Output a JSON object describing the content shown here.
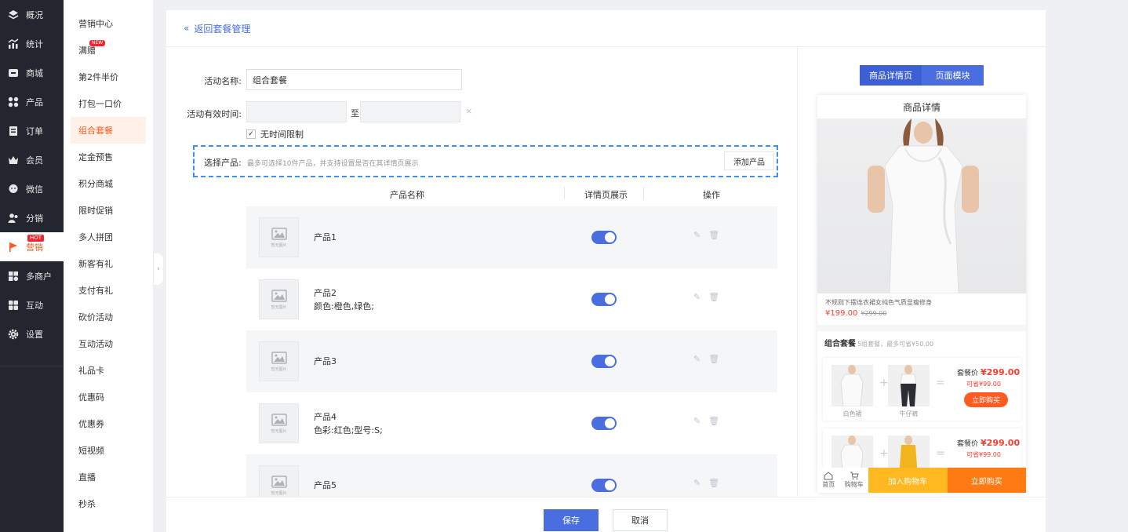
{
  "nav": {
    "items": [
      {
        "label": "概况",
        "icon": "layers-icon"
      },
      {
        "label": "统计",
        "icon": "chart-icon"
      },
      {
        "label": "商城",
        "icon": "store-icon"
      },
      {
        "label": "产品",
        "icon": "grid-icon"
      },
      {
        "label": "订单",
        "icon": "order-icon"
      },
      {
        "label": "会员",
        "icon": "crown-icon"
      },
      {
        "label": "微信",
        "icon": "wechat-icon"
      },
      {
        "label": "分销",
        "icon": "distribution-icon"
      },
      {
        "label": "营销",
        "icon": "flag-icon",
        "badge": "HOT"
      },
      {
        "label": "多商户",
        "icon": "merchant-icon"
      },
      {
        "label": "互动",
        "icon": "interaction-icon"
      },
      {
        "label": "设置",
        "icon": "gear-icon"
      }
    ]
  },
  "subnav": {
    "items": [
      {
        "label": "营销中心"
      },
      {
        "label": "满赠",
        "badge": "NEW"
      },
      {
        "label": "第2件半价"
      },
      {
        "label": "打包一口价"
      },
      {
        "label": "组合套餐"
      },
      {
        "label": "定金预售"
      },
      {
        "label": "积分商城"
      },
      {
        "label": "限时促销"
      },
      {
        "label": "多人拼团"
      },
      {
        "label": "新客有礼"
      },
      {
        "label": "支付有礼"
      },
      {
        "label": "砍价活动"
      },
      {
        "label": "互动活动"
      },
      {
        "label": "礼品卡"
      },
      {
        "label": "优惠码"
      },
      {
        "label": "优惠券"
      },
      {
        "label": "短视频"
      },
      {
        "label": "直播"
      },
      {
        "label": "秒杀"
      }
    ]
  },
  "header": {
    "back": "返回套餐管理"
  },
  "form": {
    "name_label": "活动名称:",
    "name_value": "组合套餐",
    "time_label": "活动有效时间:",
    "time_sep": "至",
    "no_limit": "无时间限制",
    "select_label": "选择产品:",
    "select_hint": "最多可选择10件产品，并支持设置是否在其详情页展示",
    "add_button": "添加产品"
  },
  "table": {
    "headers": [
      "产品名称",
      "详情页展示",
      "操作"
    ],
    "placeholder": "暂无图片",
    "rows": [
      {
        "name": "产品1",
        "spec": ""
      },
      {
        "name": "产品2",
        "spec": "颜色:橙色,绿色;"
      },
      {
        "name": "产品3",
        "spec": ""
      },
      {
        "name": "产品4",
        "spec": "色彩:红色;型号:S;"
      },
      {
        "name": "产品5",
        "spec": ""
      }
    ]
  },
  "footer": {
    "save": "保存",
    "cancel": "取消"
  },
  "preview": {
    "tabs": [
      "商品详情页",
      "页面模块"
    ],
    "title": "商品详情",
    "product_desc": "不规则下摆连衣裙女纯色气质显瘦修身",
    "price": "¥199.00",
    "orig_price": "¥299.00",
    "combo_title": "组合套餐",
    "combo_sub": "5组套餐，最多可省¥50.00",
    "card1": {
      "item1": "白色裙",
      "item2": "牛仔裤",
      "label": "套餐价",
      "price": "¥299.00",
      "save": "可省¥99.00",
      "buy": "立即购买"
    },
    "card2": {
      "label": "套餐价",
      "price": "¥299.00",
      "save": "可省¥99.00"
    },
    "bar": {
      "home": "首页",
      "cart": "购物车",
      "add_cart": "加入购物车",
      "buy_now": "立即购买"
    }
  },
  "colors": {
    "primary": "#4a6ee0",
    "accent": "#ff5a1f",
    "price": "#ff3b30"
  }
}
